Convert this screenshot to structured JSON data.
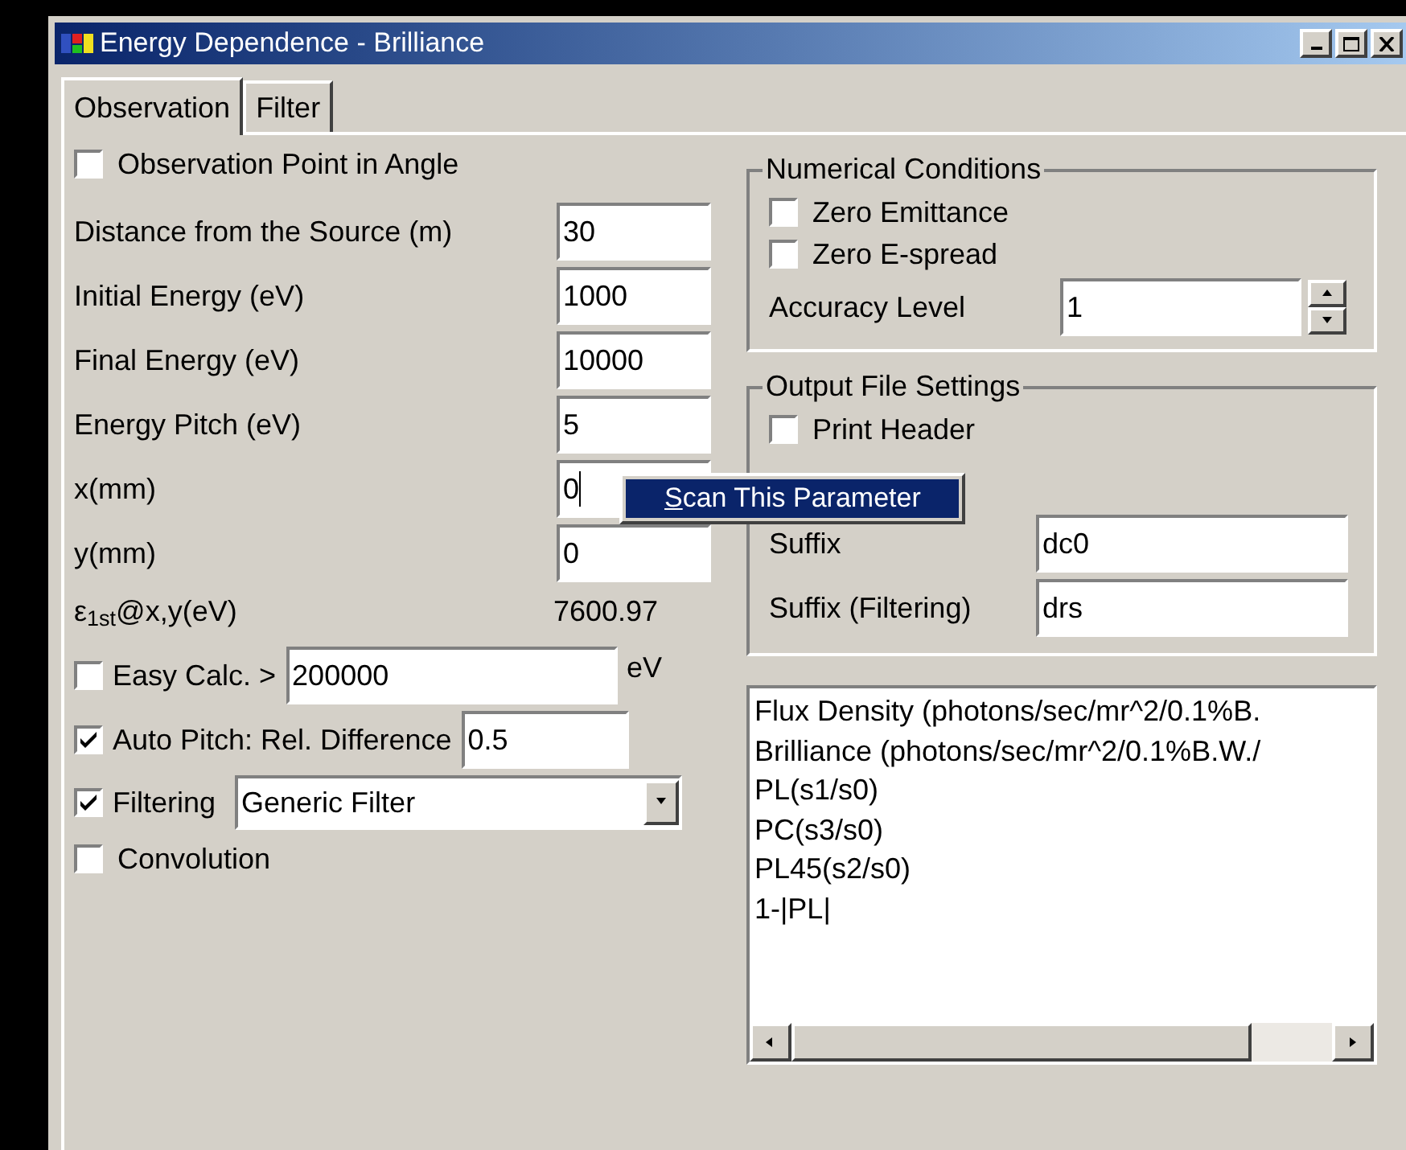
{
  "window": {
    "title": "Energy Dependence - Brilliance"
  },
  "tabs": [
    {
      "label": "Observation",
      "selected": true
    },
    {
      "label": "Filter",
      "selected": false
    }
  ],
  "observation_point": {
    "label": "Observation Point in Angle",
    "checked": false
  },
  "fields": [
    {
      "label": "Distance from the Source (m)",
      "value": "30",
      "focused": false
    },
    {
      "label": "Initial Energy (eV)",
      "value": "1000",
      "focused": false
    },
    {
      "label": "Final Energy (eV)",
      "value": "10000",
      "focused": false
    },
    {
      "label": "Energy Pitch (eV)",
      "value": "5",
      "focused": false
    },
    {
      "label": "x(mm)",
      "value": "0",
      "focused": true
    },
    {
      "label": "y(mm)",
      "value": "0",
      "focused": false
    }
  ],
  "energy_readout": {
    "label": "ε$_{1st}$@x,y(eV)",
    "value": "7600.97"
  },
  "easy_calc": {
    "label": "Easy Calc. >",
    "checked": false,
    "value": "200000",
    "unit": "eV"
  },
  "auto_pitch": {
    "label": "Auto Pitch: Rel. Difference",
    "checked": true,
    "value": "0.5"
  },
  "filtering": {
    "label": "Filtering",
    "checked": true,
    "value": "Generic Filter"
  },
  "convolution": {
    "label": "Convolution",
    "checked": false
  },
  "numerical_conditions": {
    "title": "Numerical Conditions",
    "options": [
      {
        "label": "Zero Emittance",
        "checked": false
      },
      {
        "label": "Zero E-spread",
        "checked": false
      }
    ],
    "accuracy": {
      "label": "Accuracy Level",
      "value": "1"
    }
  },
  "output_file_settings": {
    "title": "Output File Settings",
    "options": [
      {
        "label": "Print Header",
        "checked": false
      }
    ],
    "fields": [
      {
        "label": "Suffix",
        "value": "dc0"
      },
      {
        "label": "Suffix (Filtering)",
        "value": "drs"
      }
    ]
  },
  "output_list": {
    "items": [
      "Flux Density (photons/sec/mr^2/0.1%B.",
      "Brilliance (photons/sec/mr^2/0.1%B.W./",
      "PL(s1/s0)",
      "PC(s3/s0)",
      "PL45(s2/s0)",
      "1-|PL|"
    ]
  },
  "context_menu": {
    "items": [
      {
        "label": "Scan This Parameter",
        "selected": true
      }
    ]
  }
}
